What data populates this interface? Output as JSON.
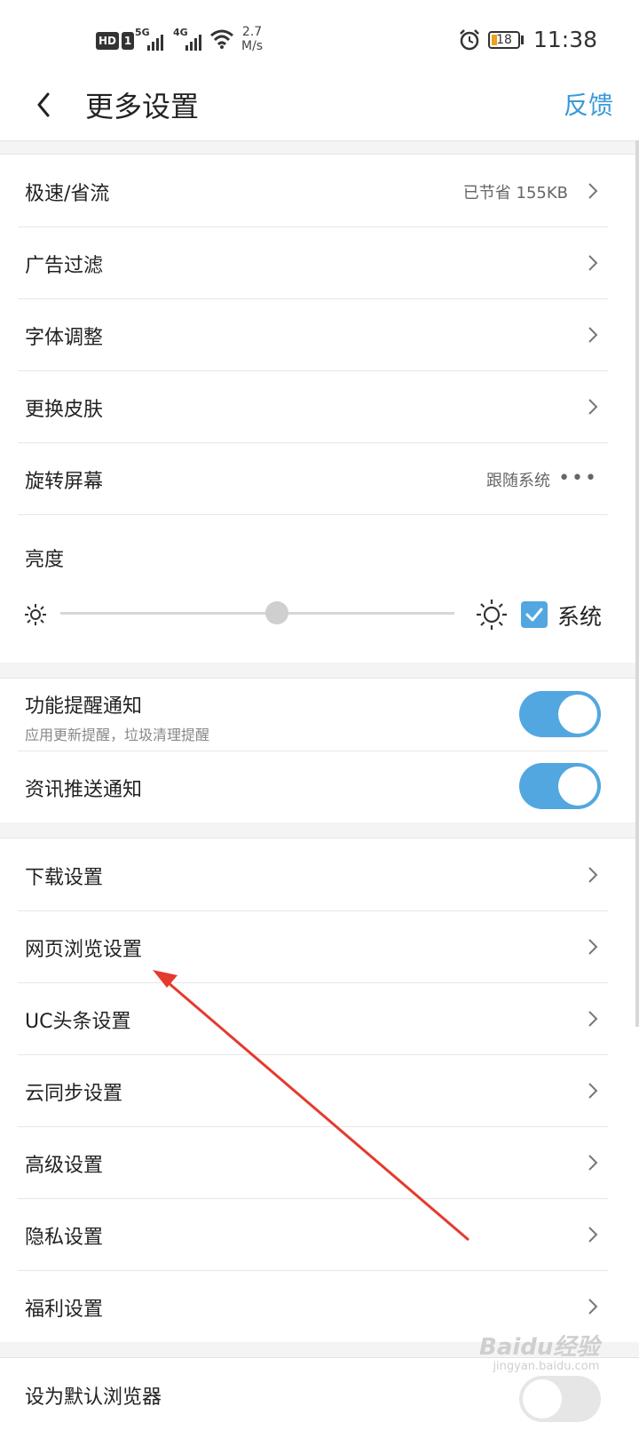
{
  "status_bar": {
    "hd": "HD",
    "sim": "1",
    "net1": "5G",
    "net2": "4G",
    "speed_value": "2.7",
    "speed_unit": "M/s",
    "battery": "18",
    "time": "11:38"
  },
  "header": {
    "title": "更多设置",
    "feedback": "反馈"
  },
  "group1": {
    "speed_save": {
      "label": "极速/省流",
      "value": "已节省 155KB"
    },
    "ad_filter": {
      "label": "广告过滤"
    },
    "font_adjust": {
      "label": "字体调整"
    },
    "skin": {
      "label": "更换皮肤"
    },
    "rotate": {
      "label": "旋转屏幕",
      "value": "跟随系统",
      "more": "•••"
    },
    "brightness": {
      "label": "亮度",
      "system_label": "系统",
      "level": 0.55,
      "system_checked": true
    }
  },
  "group2": {
    "feature_notify": {
      "label": "功能提醒通知",
      "sub": "应用更新提醒，垃圾清理提醒",
      "on": true
    },
    "news_notify": {
      "label": "资讯推送通知",
      "on": true
    }
  },
  "group3": {
    "items": [
      {
        "label": "下载设置"
      },
      {
        "label": "网页浏览设置"
      },
      {
        "label": "UC头条设置"
      },
      {
        "label": "云同步设置"
      },
      {
        "label": "高级设置"
      },
      {
        "label": "隐私设置"
      },
      {
        "label": "福利设置"
      }
    ]
  },
  "group4": {
    "default_browser": {
      "label": "设为默认浏览器"
    }
  },
  "watermark": {
    "brand": "Baidu经验",
    "url": "jingyan.baidu.com"
  },
  "colors": {
    "accent": "#52a7e0",
    "link": "#3a9ad9",
    "annotation": "#e53a2e"
  }
}
